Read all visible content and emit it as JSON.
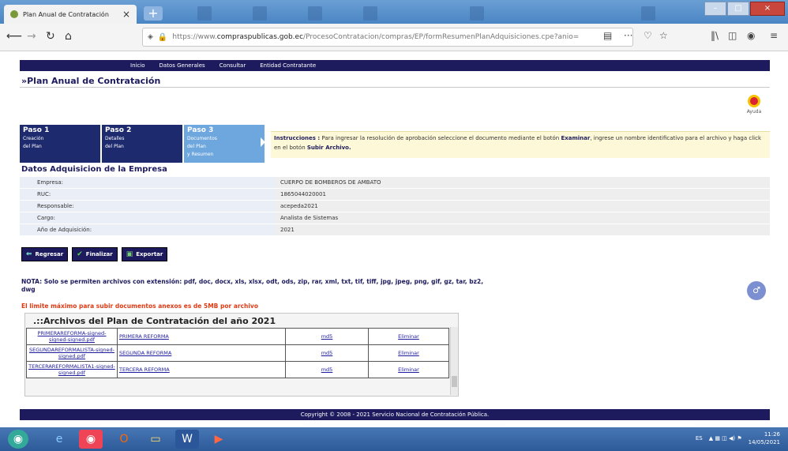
{
  "browser": {
    "tab_title": "Plan Anual de Contratación",
    "tab_close": "×",
    "new_tab": "+",
    "url_prefix": "https://www.",
    "url_domain": "compraspublicas.gob.ec",
    "url_rest": "/ProcesoContratacion/compras/EP/formResumenPlanAdquisiciones.cpe?anio=",
    "overflow_menu": "···"
  },
  "site_menu": [
    "Inicio",
    "Datos Generales",
    "Consultar",
    "Entidad Contratante"
  ],
  "page_title": "»Plan Anual de Contratación",
  "help_label": "Ayuda",
  "steps": [
    {
      "num": "Paso 1",
      "desc": "Creación\ndel Plan"
    },
    {
      "num": "Paso 2",
      "desc": "Detalles\ndel Plan"
    },
    {
      "num": "Paso 3",
      "desc": "Documentos\ndel Plan\ny Resumen"
    }
  ],
  "instructions": {
    "label": "Instrucciones :",
    "text1": " Para ingresar la resolución de aprobación seleccione el documento mediante el botón ",
    "examinar": "Examinar",
    "text2": ", ingrese un nombre identificativo para el archivo y haga click en el botón ",
    "subir": "Subir Archivo."
  },
  "section_title": "Datos Adquisicion de la Empresa",
  "info": [
    {
      "label": "Empresa:",
      "value": "CUERPO DE BOMBEROS DE AMBATO"
    },
    {
      "label": "RUC:",
      "value": "1865044020001"
    },
    {
      "label": "Responsable:",
      "value": "acepeda2021"
    },
    {
      "label": "Cargo:",
      "value": "Analista de Sistemas"
    },
    {
      "label": "Año de Adquisición:",
      "value": "2021"
    }
  ],
  "buttons": {
    "back": "Regresar",
    "finish": "Finalizar",
    "export": "Exportar"
  },
  "note": "NOTA: Solo se permiten archivos con extensión: pdf, doc, docx, xls, xlsx, odt, ods, zip, rar, xml, txt, tif, tiff, jpg, jpeg, png, gif, gz, tar, bz2, dwg",
  "limit": "El limite máximo para subir documentos anexos es de 5MB por archivo",
  "files_title": ".::Archivos del Plan de Contratación del año 2021",
  "files": [
    {
      "file": "PRIMERAREFORMA-signed-signed-signed.pdf",
      "name": "PRIMERA REFORMA",
      "md5": "md5",
      "del": "Eliminar"
    },
    {
      "file": "SEGUNDAREFORMALISTA-signed-signed.pdf",
      "name": "SEGUNDA REFORMA",
      "md5": "md5",
      "del": "Eliminar"
    },
    {
      "file": "TERCERAREFORMALISTA1-signed-signed.pdf",
      "name": "TERCERA REFORMA",
      "md5": "md5",
      "del": "Eliminar"
    }
  ],
  "footer": "Copyright © 2008 - 2021 Servicio Nacional de Contratación Pública.",
  "taskbar": {
    "lang": "ES",
    "time": "11:26",
    "date": "14/05/2021"
  },
  "colors": {
    "header_navy": "#1d1b5e",
    "step_active": "#6ea7de",
    "limit_red": "#e03a14"
  }
}
